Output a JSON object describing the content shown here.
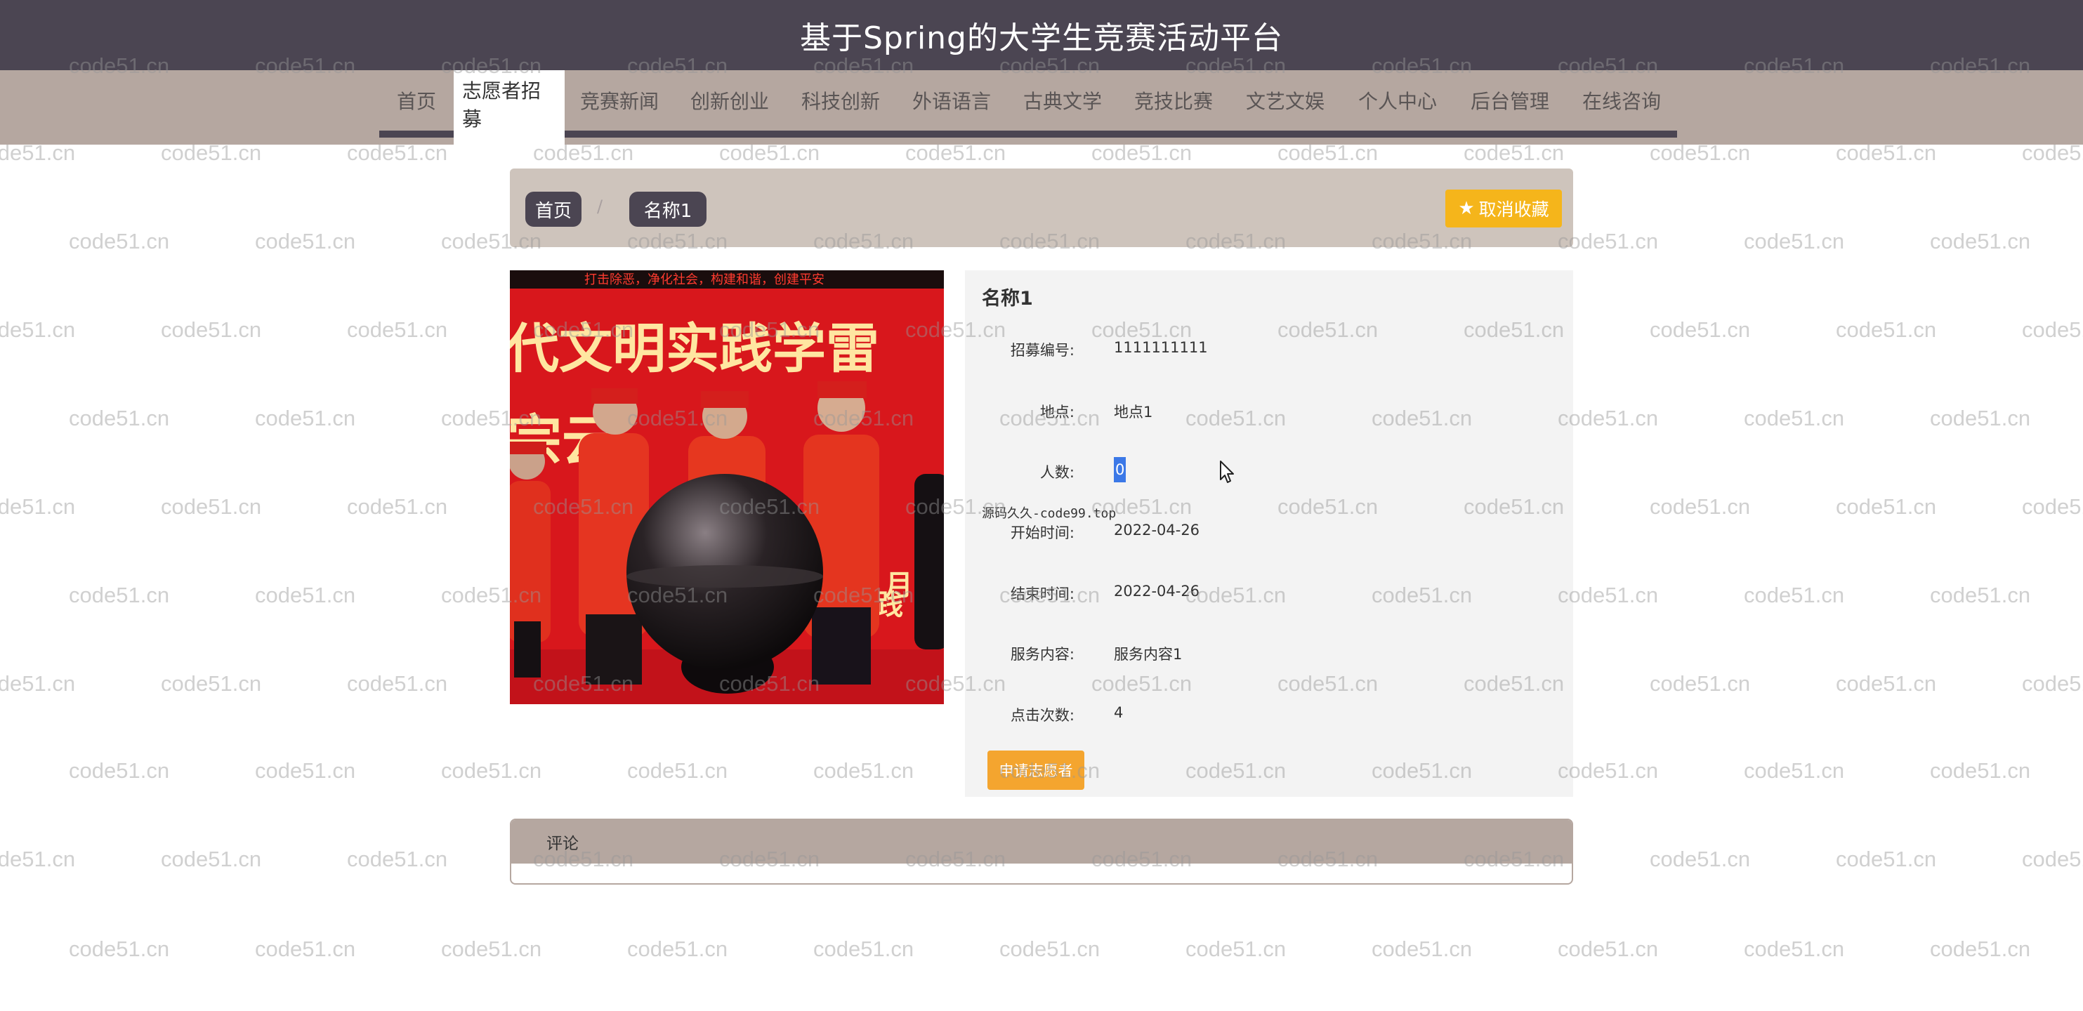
{
  "header": {
    "site_title": "基于Spring的大学生竞赛活动平台"
  },
  "nav": {
    "items": [
      {
        "label": "首页",
        "active": false
      },
      {
        "label": "志愿者招募",
        "active": true
      },
      {
        "label": "竞赛新闻",
        "active": false
      },
      {
        "label": "创新创业",
        "active": false
      },
      {
        "label": "科技创新",
        "active": false
      },
      {
        "label": "外语语言",
        "active": false
      },
      {
        "label": "古典文学",
        "active": false
      },
      {
        "label": "竞技比赛",
        "active": false
      },
      {
        "label": "文艺文娱",
        "active": false
      },
      {
        "label": "个人中心",
        "active": false
      },
      {
        "label": "后台管理",
        "active": false
      },
      {
        "label": "在线咨询",
        "active": false
      }
    ]
  },
  "breadcrumb": {
    "home": "首页",
    "separator": "/",
    "current": "名称1"
  },
  "favorite": {
    "icon": "star-icon",
    "label": "取消收藏"
  },
  "photo": {
    "banner_text": "打击除恶，净化社会，构建和谐，创建平安",
    "slogan_text": "代文明实践学雷",
    "slogan_text_2": "宗云",
    "slogan_text_3": "践",
    "slogan_text_4": "月"
  },
  "detail": {
    "title": "名称1",
    "fields": [
      {
        "label": "招募编号:",
        "value": "1111111111"
      },
      {
        "label": "地点:",
        "value": "地点1"
      },
      {
        "label": "人数:",
        "value": "0"
      },
      {
        "label": "开始时间:",
        "value": "2022-04-26"
      },
      {
        "label": "结束时间:",
        "value": "2022-04-26"
      },
      {
        "label": "服务内容:",
        "value": "服务内容1"
      },
      {
        "label": "点击次数:",
        "value": "4"
      }
    ],
    "source_note": "源码久久-code99.top",
    "apply_button": "申请志愿者"
  },
  "comments": {
    "title": "评论"
  },
  "watermark": {
    "text": "code51.cn"
  },
  "colors": {
    "header": "#4b4552",
    "nav": "#b5a7a0",
    "accent_button": "#f5b51b",
    "apply_button": "#f4a52f"
  }
}
